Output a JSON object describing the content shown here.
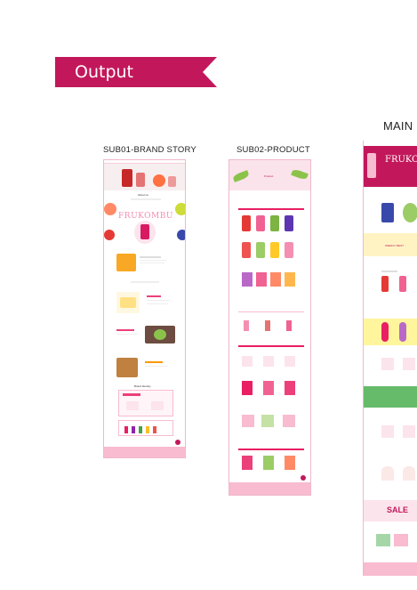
{
  "ribbon": {
    "label": "Output",
    "color": "#c2185b"
  },
  "columns": [
    {
      "label": "SUB01-BRAND STORY"
    },
    {
      "label": "SUB02-PRODUCT"
    },
    {
      "label": "MAIN"
    }
  ],
  "sub01": {
    "brand_word": "FRUKOMBU",
    "about_title": "About us",
    "section_title": "Brand Identity"
  },
  "sub02": {
    "header_word": "Product"
  },
  "main": {
    "hero_word": "FRUKO",
    "sale_word": "SALE",
    "banner_text": "WEEKLY BEST"
  },
  "colors": {
    "accent": "#c2185b",
    "light_pink": "#fbe3ec",
    "pink": "#f48fb1"
  }
}
